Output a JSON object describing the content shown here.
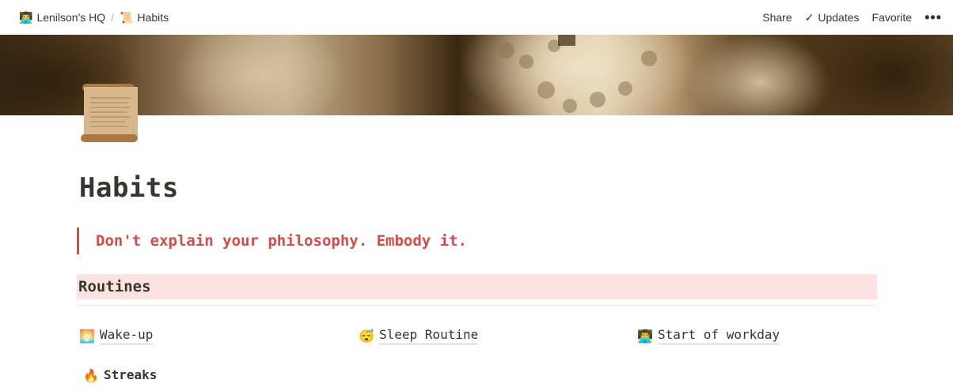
{
  "breadcrumb": [
    {
      "icon": "👨‍💻",
      "label": "Lenilson's HQ"
    },
    {
      "icon": "📜",
      "label": "Habits"
    }
  ],
  "breadcrumb_separator": "/",
  "header_actions": {
    "share": "Share",
    "updates": "Updates",
    "favorite": "Favorite",
    "more": "•••"
  },
  "page": {
    "icon": "scroll-icon",
    "title": "Habits",
    "quote": "Don't explain your philosophy. Embody it.",
    "section_heading": "Routines"
  },
  "links": [
    {
      "icon": "🌅",
      "label": "Wake-up"
    },
    {
      "icon": "😴",
      "label": "Sleep Routine"
    },
    {
      "icon": "👨‍💻",
      "label": "Start of workday"
    },
    {
      "icon": "🔥",
      "label": "Streaks"
    }
  ],
  "colors": {
    "quote_red": "#d44c47",
    "heading_bg": "#fde2e2",
    "text": "#37352f"
  }
}
